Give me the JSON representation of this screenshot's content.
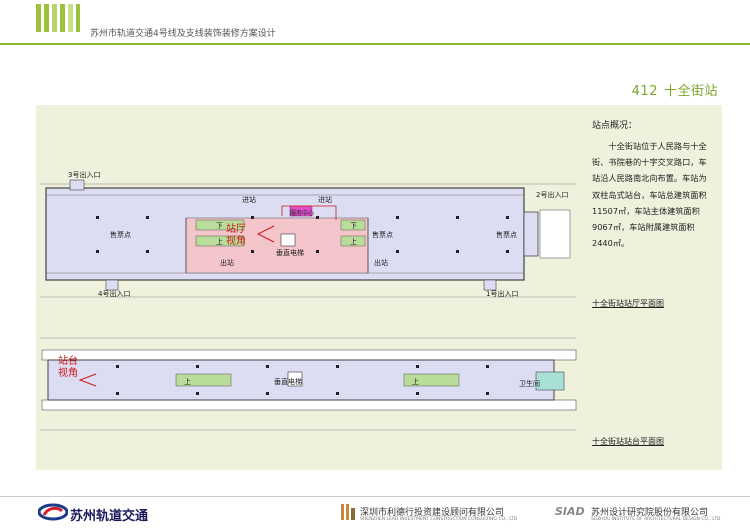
{
  "header": {
    "title": "苏州市轨道交通4号线及支线装饰装修方案设计"
  },
  "station": {
    "number": "412",
    "name": "十全街站"
  },
  "overview": {
    "label": "站点概况：",
    "text": "十全街站位于人民路与十全街、书院巷的十字交叉路口，车站沿人民路南北向布置。车站为双柱岛式站台，车站总建筑面积11507㎡，车站主体建筑面积9067㎡，车站附属建筑面积2440㎡。"
  },
  "concourse_plan": {
    "caption": "十全街站站厅平面图",
    "labels": {
      "exit3": "3号出入口",
      "exit2": "2号出入口",
      "exit4": "4号出入口",
      "exit1": "1号出入口",
      "ticket_left": "售票点",
      "ticket_mid": "售票点",
      "ticket_right": "售票点",
      "enter_left": "进站",
      "enter_right": "进站",
      "exit_left": "出站",
      "exit_right": "出站",
      "elevator": "垂直电梯",
      "service": "服务中心",
      "down_left": "下",
      "up_left": "上",
      "down_right": "下",
      "up_right": "上",
      "view_line1": "站厅",
      "view_line2": "视角"
    }
  },
  "platform_plan": {
    "caption": "十全街站站台平面图",
    "labels": {
      "up_left": "上",
      "up_right": "上",
      "elevator": "垂直电梯",
      "toilet": "卫生间",
      "view_line1": "站台",
      "view_line2": "视角"
    }
  },
  "footer": {
    "client": "苏州轨道交通",
    "lead_name": "深圳市利德行投资建设顾问有限公司",
    "lead_en": "SHENZHEN LEAD INVESTMENT CONSTRUCTION CONSULTING CO., LTD",
    "siad_mark": "SIAD",
    "siad_name": "苏州设计研究院股份有限公司",
    "siad_en": "SUZHOU INSTITUTE OF ARCHITECTURAL DESIGN CO., LTD"
  },
  "colors": {
    "accent": "#8db32e",
    "concourse_fill": "#dcdcf2",
    "paid_zone": "#f4c6cc",
    "stair_green": "#b9dc9a",
    "annotation_red": "#d01818"
  }
}
